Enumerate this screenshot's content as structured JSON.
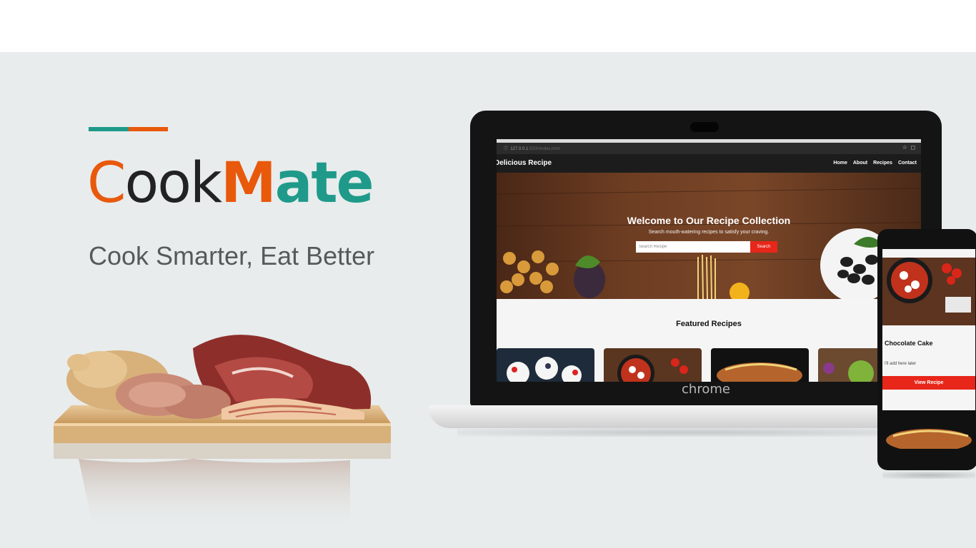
{
  "brand": {
    "part1": "C",
    "part2": "ook",
    "part3": "M",
    "part4": "ate"
  },
  "tagline": "Cook Smarter, Eat Better",
  "colors": {
    "orange": "#e8590c",
    "teal": "#1f9a8a",
    "button_red": "#e8261a",
    "background": "#e8ecec"
  },
  "laptop": {
    "logo": "chrome",
    "browser": {
      "url_host": "127.0.0.1",
      "url_path": ":5500/index.html",
      "icons": [
        "star-icon",
        "extension-icon"
      ]
    },
    "site": {
      "title": "Delicious Recipe",
      "nav": [
        "Home",
        "About",
        "Recipes",
        "Contact"
      ],
      "hero_title": "Welcome to Our Recipe Collection",
      "hero_subtitle": "Search mouth-watering recipes to satisfy your craving.",
      "search_placeholder": "Search Recipe",
      "search_button": "Search",
      "featured_heading": "Featured Recipes"
    }
  },
  "phone": {
    "card_title": "Chocolate Cake",
    "card_desc": "I'll add here later",
    "card_button": "View Recipe"
  }
}
